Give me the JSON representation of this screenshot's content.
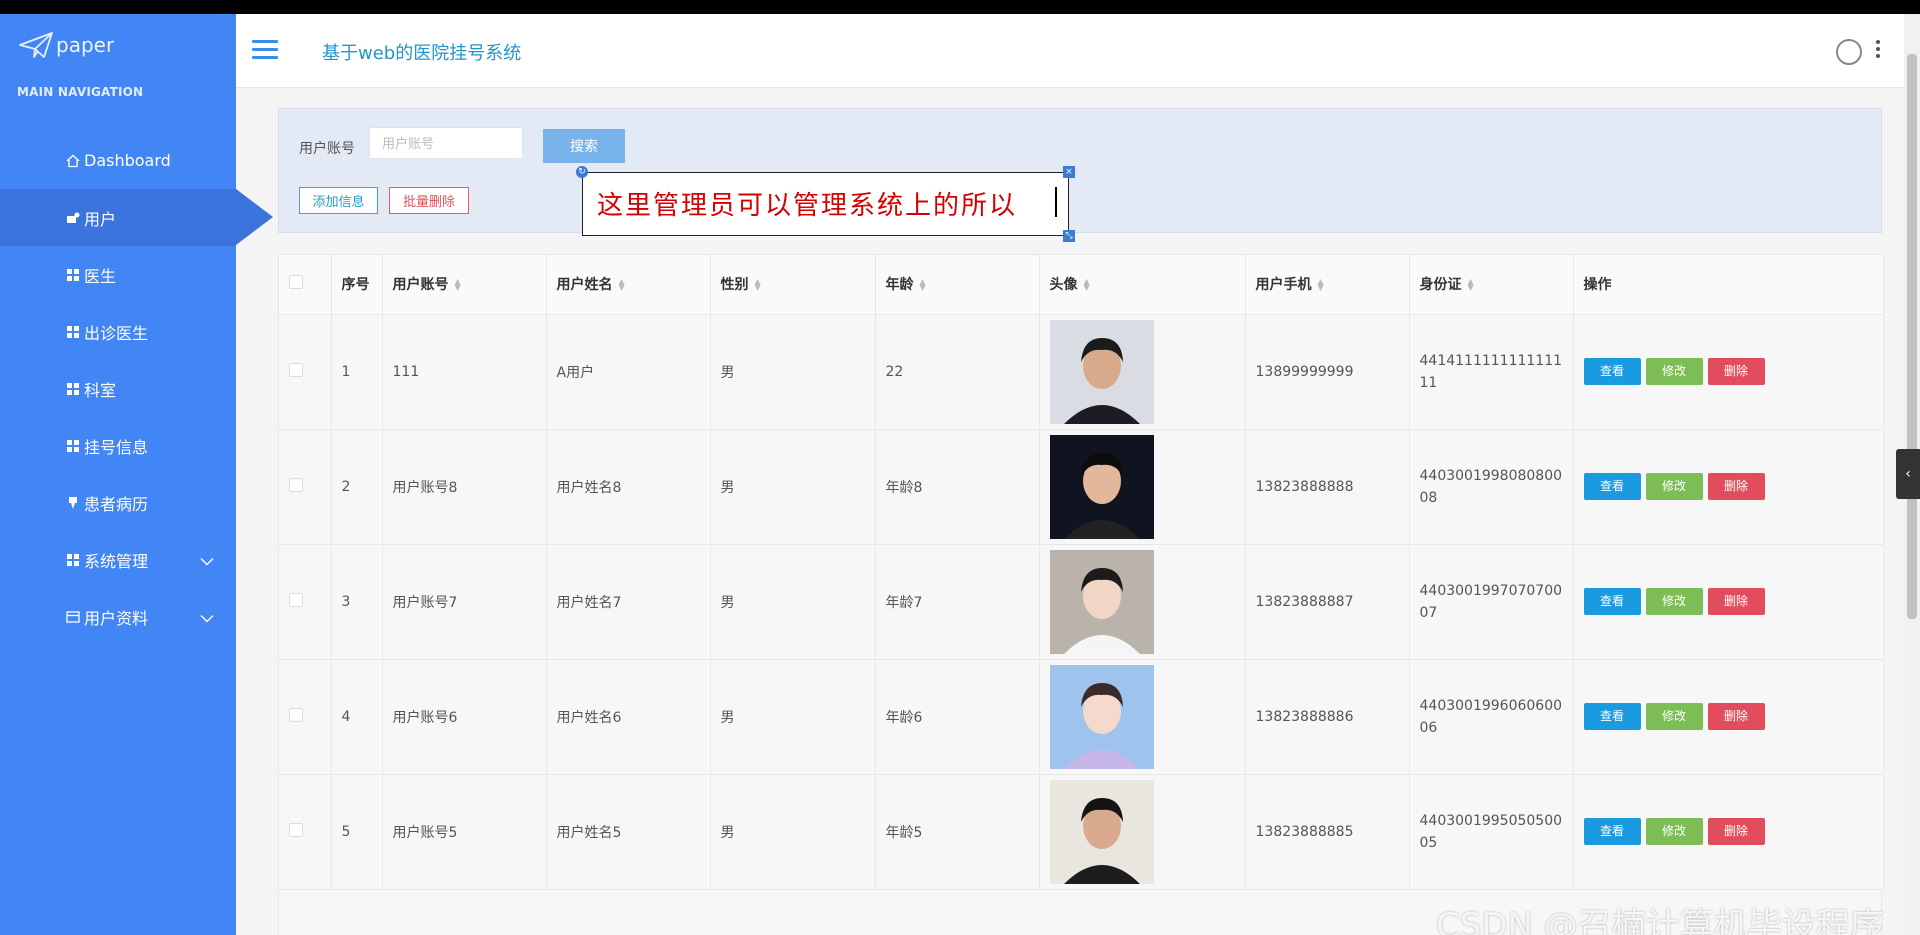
{
  "sidebar": {
    "logo_text": "paper",
    "nav_header": "MAIN NAVIGATION",
    "items": [
      {
        "label": "Dashboard",
        "icon": "home-icon"
      },
      {
        "label": "用户",
        "icon": "user-icon",
        "active": true
      },
      {
        "label": "医生",
        "icon": "grid-icon"
      },
      {
        "label": "出诊医生",
        "icon": "grid-icon"
      },
      {
        "label": "科室",
        "icon": "grid-icon"
      },
      {
        "label": "挂号信息",
        "icon": "grid-icon"
      },
      {
        "label": "患者病历",
        "icon": "pin-icon"
      },
      {
        "label": "系统管理",
        "icon": "grid-icon",
        "expandable": true
      },
      {
        "label": "用户资料",
        "icon": "card-icon",
        "expandable": true
      }
    ]
  },
  "header": {
    "title": "基于web的医院挂号系统"
  },
  "search": {
    "label": "用户账号",
    "placeholder": "用户账号",
    "value": "",
    "search_button": "搜索",
    "add_button": "添加信息",
    "batch_delete_button": "批量删除"
  },
  "annotation": {
    "text": "这里管理员可以管理系统上的所以"
  },
  "table": {
    "columns": [
      "",
      "序号",
      "用户账号",
      "用户姓名",
      "性别",
      "年龄",
      "头像",
      "用户手机",
      "身份证",
      "操作"
    ],
    "rows": [
      {
        "no": "1",
        "account": "111",
        "name": "A用户",
        "gender": "男",
        "age": "22",
        "phone": "13899999999",
        "id_card": "441411111111111111"
      },
      {
        "no": "2",
        "account": "用户账号8",
        "name": "用户姓名8",
        "gender": "男",
        "age": "年龄8",
        "phone": "13823888888",
        "id_card": "440300199808080008"
      },
      {
        "no": "3",
        "account": "用户账号7",
        "name": "用户姓名7",
        "gender": "男",
        "age": "年龄7",
        "phone": "13823888887",
        "id_card": "440300199707070007"
      },
      {
        "no": "4",
        "account": "用户账号6",
        "name": "用户姓名6",
        "gender": "男",
        "age": "年龄6",
        "phone": "13823888886",
        "id_card": "440300199606060006"
      },
      {
        "no": "5",
        "account": "用户账号5",
        "name": "用户姓名5",
        "gender": "男",
        "age": "年龄5",
        "phone": "13823888885",
        "id_card": "440300199505050005"
      }
    ],
    "actions": {
      "view": "查看",
      "edit": "修改",
      "delete": "删除"
    }
  },
  "watermark": "CSDN @召楠计算机毕设程序",
  "colors": {
    "sidebar_bg": "#4285f4",
    "title_color": "#2196c9",
    "view_btn": "#1a9be0",
    "edit_btn": "#7cbe55",
    "delete_btn": "#e24d5e",
    "annotation_text": "#d40000"
  }
}
